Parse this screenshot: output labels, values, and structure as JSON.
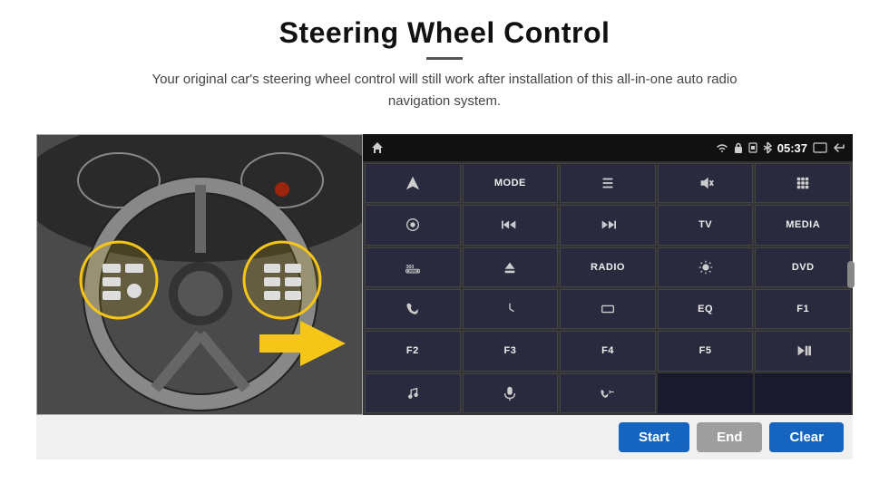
{
  "header": {
    "title": "Steering Wheel Control",
    "subtitle": "Your original car's steering wheel control will still work after installation of this all-in-one auto radio navigation system."
  },
  "status_bar": {
    "time": "05:37",
    "icons": [
      "wifi",
      "lock",
      "sim",
      "bluetooth",
      "screen",
      "back"
    ]
  },
  "panel_buttons": [
    {
      "id": "r1c1",
      "type": "icon",
      "icon": "navigate",
      "label": ""
    },
    {
      "id": "r1c2",
      "type": "text",
      "label": "MODE"
    },
    {
      "id": "r1c3",
      "type": "icon",
      "icon": "list",
      "label": ""
    },
    {
      "id": "r1c4",
      "type": "icon",
      "icon": "mute",
      "label": ""
    },
    {
      "id": "r1c5",
      "type": "icon",
      "icon": "apps",
      "label": ""
    },
    {
      "id": "r2c1",
      "type": "icon",
      "icon": "settings-circle",
      "label": ""
    },
    {
      "id": "r2c2",
      "type": "icon",
      "icon": "rewind",
      "label": ""
    },
    {
      "id": "r2c3",
      "type": "icon",
      "icon": "fastforward",
      "label": ""
    },
    {
      "id": "r2c4",
      "type": "text",
      "label": "TV"
    },
    {
      "id": "r2c5",
      "type": "text",
      "label": "MEDIA"
    },
    {
      "id": "r3c1",
      "type": "icon",
      "icon": "360-car",
      "label": ""
    },
    {
      "id": "r3c2",
      "type": "icon",
      "icon": "eject",
      "label": ""
    },
    {
      "id": "r3c3",
      "type": "text",
      "label": "RADIO"
    },
    {
      "id": "r3c4",
      "type": "icon",
      "icon": "brightness",
      "label": ""
    },
    {
      "id": "r3c5",
      "type": "text",
      "label": "DVD"
    },
    {
      "id": "r4c1",
      "type": "icon",
      "icon": "phone",
      "label": ""
    },
    {
      "id": "r4c2",
      "type": "icon",
      "icon": "yelp",
      "label": ""
    },
    {
      "id": "r4c3",
      "type": "icon",
      "icon": "rectangle",
      "label": ""
    },
    {
      "id": "r4c4",
      "type": "text",
      "label": "EQ"
    },
    {
      "id": "r4c5",
      "type": "text",
      "label": "F1"
    },
    {
      "id": "r5c1",
      "type": "text",
      "label": "F2"
    },
    {
      "id": "r5c2",
      "type": "text",
      "label": "F3"
    },
    {
      "id": "r5c3",
      "type": "text",
      "label": "F4"
    },
    {
      "id": "r5c4",
      "type": "text",
      "label": "F5"
    },
    {
      "id": "r5c5",
      "type": "icon",
      "icon": "play-pause",
      "label": ""
    },
    {
      "id": "r6c1",
      "type": "icon",
      "icon": "music",
      "label": ""
    },
    {
      "id": "r6c2",
      "type": "icon",
      "icon": "mic",
      "label": ""
    },
    {
      "id": "r6c3",
      "type": "icon",
      "icon": "vol-phone",
      "label": ""
    },
    {
      "id": "r6c4",
      "type": "empty",
      "label": ""
    },
    {
      "id": "r6c5",
      "type": "empty",
      "label": ""
    }
  ],
  "bottom_bar": {
    "start_label": "Start",
    "end_label": "End",
    "clear_label": "Clear"
  }
}
